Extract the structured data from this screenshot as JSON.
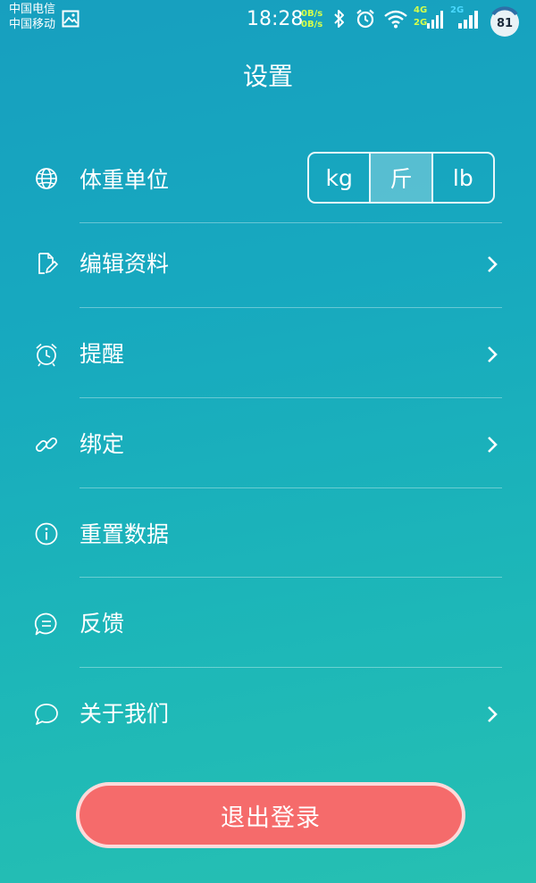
{
  "status_bar": {
    "carrier_1": "中国电信",
    "carrier_2": "中国移动",
    "time": "18:28",
    "net_up": "0B/s",
    "net_down": "0B/s",
    "sim1_network": "4G",
    "sim1_network_2": "2G",
    "sim2_network": "2G",
    "battery": "81",
    "icons": [
      "gallery-icon",
      "bluetooth-icon",
      "alarm-icon",
      "wifi-icon",
      "signal-icon",
      "battery-icon"
    ]
  },
  "header": {
    "title": "设置"
  },
  "weight_unit": {
    "label": "体重单位",
    "icon": "globe-icon",
    "options": [
      "kg",
      "斤",
      "lb"
    ],
    "selected": "斤"
  },
  "rows": [
    {
      "label": "编辑资料",
      "icon": "edit-document-icon",
      "has_chevron": true
    },
    {
      "label": "提醒",
      "icon": "alarm-clock-icon",
      "has_chevron": true
    },
    {
      "label": "绑定",
      "icon": "link-icon",
      "has_chevron": true
    },
    {
      "label": "重置数据",
      "icon": "info-icon",
      "has_chevron": false
    },
    {
      "label": "反馈",
      "icon": "chat-lines-icon",
      "has_chevron": false
    },
    {
      "label": "关于我们",
      "icon": "speech-bubble-icon",
      "has_chevron": true
    }
  ],
  "logout": {
    "label": "退出登录"
  },
  "colors": {
    "background_top": "#179fbf",
    "background_bottom": "#26c0b2",
    "logout_button": "#f56b6b"
  }
}
